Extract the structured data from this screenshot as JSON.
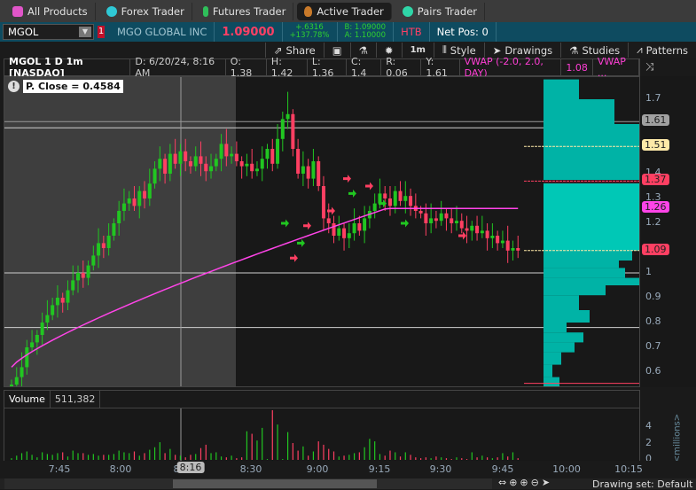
{
  "tabs": [
    {
      "label": "All Products",
      "color": "#e055c8"
    },
    {
      "label": "Forex Trader",
      "color": "#2fc9d6"
    },
    {
      "label": "Futures Trader",
      "color": "#2fbf5a"
    },
    {
      "label": "Active Trader",
      "color": "#c97a2a",
      "active": true
    },
    {
      "label": "Pairs Trader",
      "color": "#2fd6a8"
    }
  ],
  "symbol": {
    "ticker": "MGOL",
    "alert_count": "1",
    "name": "MGO GLOBAL INC",
    "last": "1.09000",
    "change": "+.6316",
    "change_pct": "+137.78%",
    "bid": "B: 1.09000",
    "ask": "A: 1.10000",
    "htb": "HTB",
    "net_pos": "Net Pos: 0"
  },
  "toolbar": {
    "share": "Share",
    "timeframe": "1m",
    "style": "Style",
    "drawings": "Drawings",
    "studies": "Studies",
    "patterns": "Patterns"
  },
  "info": {
    "title": "MGOL 1 D 1m [NASDAQ]",
    "date": "D: 6/20/24, 8:16 AM",
    "open": "O: 1.38",
    "high": "H: 1.42",
    "low": "L: 1.36",
    "close": "C: 1.4",
    "range": "R: 0.06",
    "y": "Y: 1.61",
    "vwap": "VWAP (-2.0, 2.0, DAY)",
    "vwap_val": "1.08",
    "vwap2": "VWAP ..."
  },
  "prev_close": "P. Close = 0.4584",
  "price_axis": {
    "ticks": [
      "1.7",
      "1.4",
      "1.3",
      "1.2",
      "1",
      "0.9",
      "0.8",
      "0.7",
      "0.6"
    ],
    "tick_values": [
      1.7,
      1.4,
      1.3,
      1.2,
      1.0,
      0.9,
      0.8,
      0.7,
      0.6
    ],
    "tags": [
      {
        "label": "1.61",
        "value": 1.61,
        "color": "#a0a0a0"
      },
      {
        "label": "1.51",
        "value": 1.51,
        "color": "#fde9a8"
      },
      {
        "label": "1.37",
        "value": 1.37,
        "color": "#ff3f62"
      },
      {
        "label": "1.26",
        "value": 1.26,
        "color": "#ff44e8"
      },
      {
        "label": "1.09",
        "value": 1.09,
        "color": "#ff3f62"
      }
    ]
  },
  "volume": {
    "label": "Volume",
    "value": "511,382",
    "ticks": [
      "4",
      "2",
      "0"
    ],
    "unit": "<millions>"
  },
  "time_axis": {
    "ticks": [
      "7:45",
      "8:00",
      "8",
      "8:30",
      "9:00",
      "9:15",
      "9:30",
      "9:45",
      "10:00",
      "10:15"
    ],
    "cursor": "8:16"
  },
  "footer": {
    "drawing_set": "Drawing set: Default"
  },
  "colors": {
    "up": "#21c621",
    "down": "#ff3f62",
    "vwap": "#ff44e8",
    "profile": "#00b3a6"
  },
  "chart_data": {
    "type": "candlestick",
    "closes": [
      0.55,
      0.58,
      0.62,
      0.7,
      0.72,
      0.75,
      0.8,
      0.83,
      0.87,
      0.9,
      0.88,
      0.93,
      0.97,
      1.0,
      0.98,
      1.03,
      1.07,
      1.12,
      1.1,
      1.15,
      1.2,
      1.25,
      1.28,
      1.3,
      1.27,
      1.33,
      1.3,
      1.36,
      1.42,
      1.46,
      1.4,
      1.48,
      1.44,
      1.49,
      1.45,
      1.43,
      1.47,
      1.44,
      1.41,
      1.43,
      1.46,
      1.52,
      1.47,
      1.48,
      1.45,
      1.43,
      1.44,
      1.41,
      1.42,
      1.46,
      1.5,
      1.44,
      1.54,
      1.62,
      1.64,
      1.5,
      1.4,
      1.43,
      1.38,
      1.45,
      1.35,
      1.22,
      1.2,
      1.15,
      1.18,
      1.14,
      1.16,
      1.2,
      1.17,
      1.22,
      1.25,
      1.28,
      1.32,
      1.3,
      1.27,
      1.33,
      1.29,
      1.31,
      1.27,
      1.25,
      1.24,
      1.2,
      1.22,
      1.21,
      1.24,
      1.22,
      1.2,
      1.21,
      1.18,
      1.17,
      1.19,
      1.16,
      1.17,
      1.14,
      1.15,
      1.12,
      1.13,
      1.09,
      1.1,
      1.09
    ],
    "volumes": [
      0.2,
      0.5,
      0.8,
      1.0,
      0.6,
      0.3,
      0.9,
      0.7,
      0.6,
      0.8,
      0.9,
      0.4,
      1.1,
      0.8,
      0.8,
      0.6,
      0.7,
      0.5,
      0.6,
      0.6,
      0.7,
      1.1,
      0.9,
      0.8,
      1.0,
      0.5,
      0.8,
      1.2,
      1.5,
      2.1,
      0.8,
      1.3,
      0.6,
      0.5,
      0.3,
      0.6,
      0.7,
      1.4,
      1.8,
      0.8,
      0.9,
      0.4,
      0.3,
      0.5,
      0.2,
      0.3,
      3.4,
      3.1,
      2.3,
      3.8,
      0.1,
      5.9,
      4.2,
      0.1,
      3.3,
      2.0,
      1.1,
      1.6,
      0.5,
      1.0,
      2.2,
      1.8,
      1.3,
      1.0,
      0.4,
      0.5,
      0.6,
      0.8,
      0.9,
      1.5,
      2.5,
      2.2,
      0.7,
      0.5,
      1.1,
      0.9,
      0.4,
      0.9,
      0.6,
      0.3,
      0.2,
      0.3,
      0.2,
      0.4,
      0.3,
      0.2,
      0.1,
      0.3,
      0.2,
      0.1,
      0.9,
      0.3,
      0.5,
      0.3,
      0.2,
      0.3,
      0.8,
      0.4,
      0.9,
      0.2
    ],
    "spike_high": 1.73,
    "ylim": [
      0.55,
      1.8
    ],
    "vwap_start": 0.62,
    "vwap_end": 1.26
  }
}
